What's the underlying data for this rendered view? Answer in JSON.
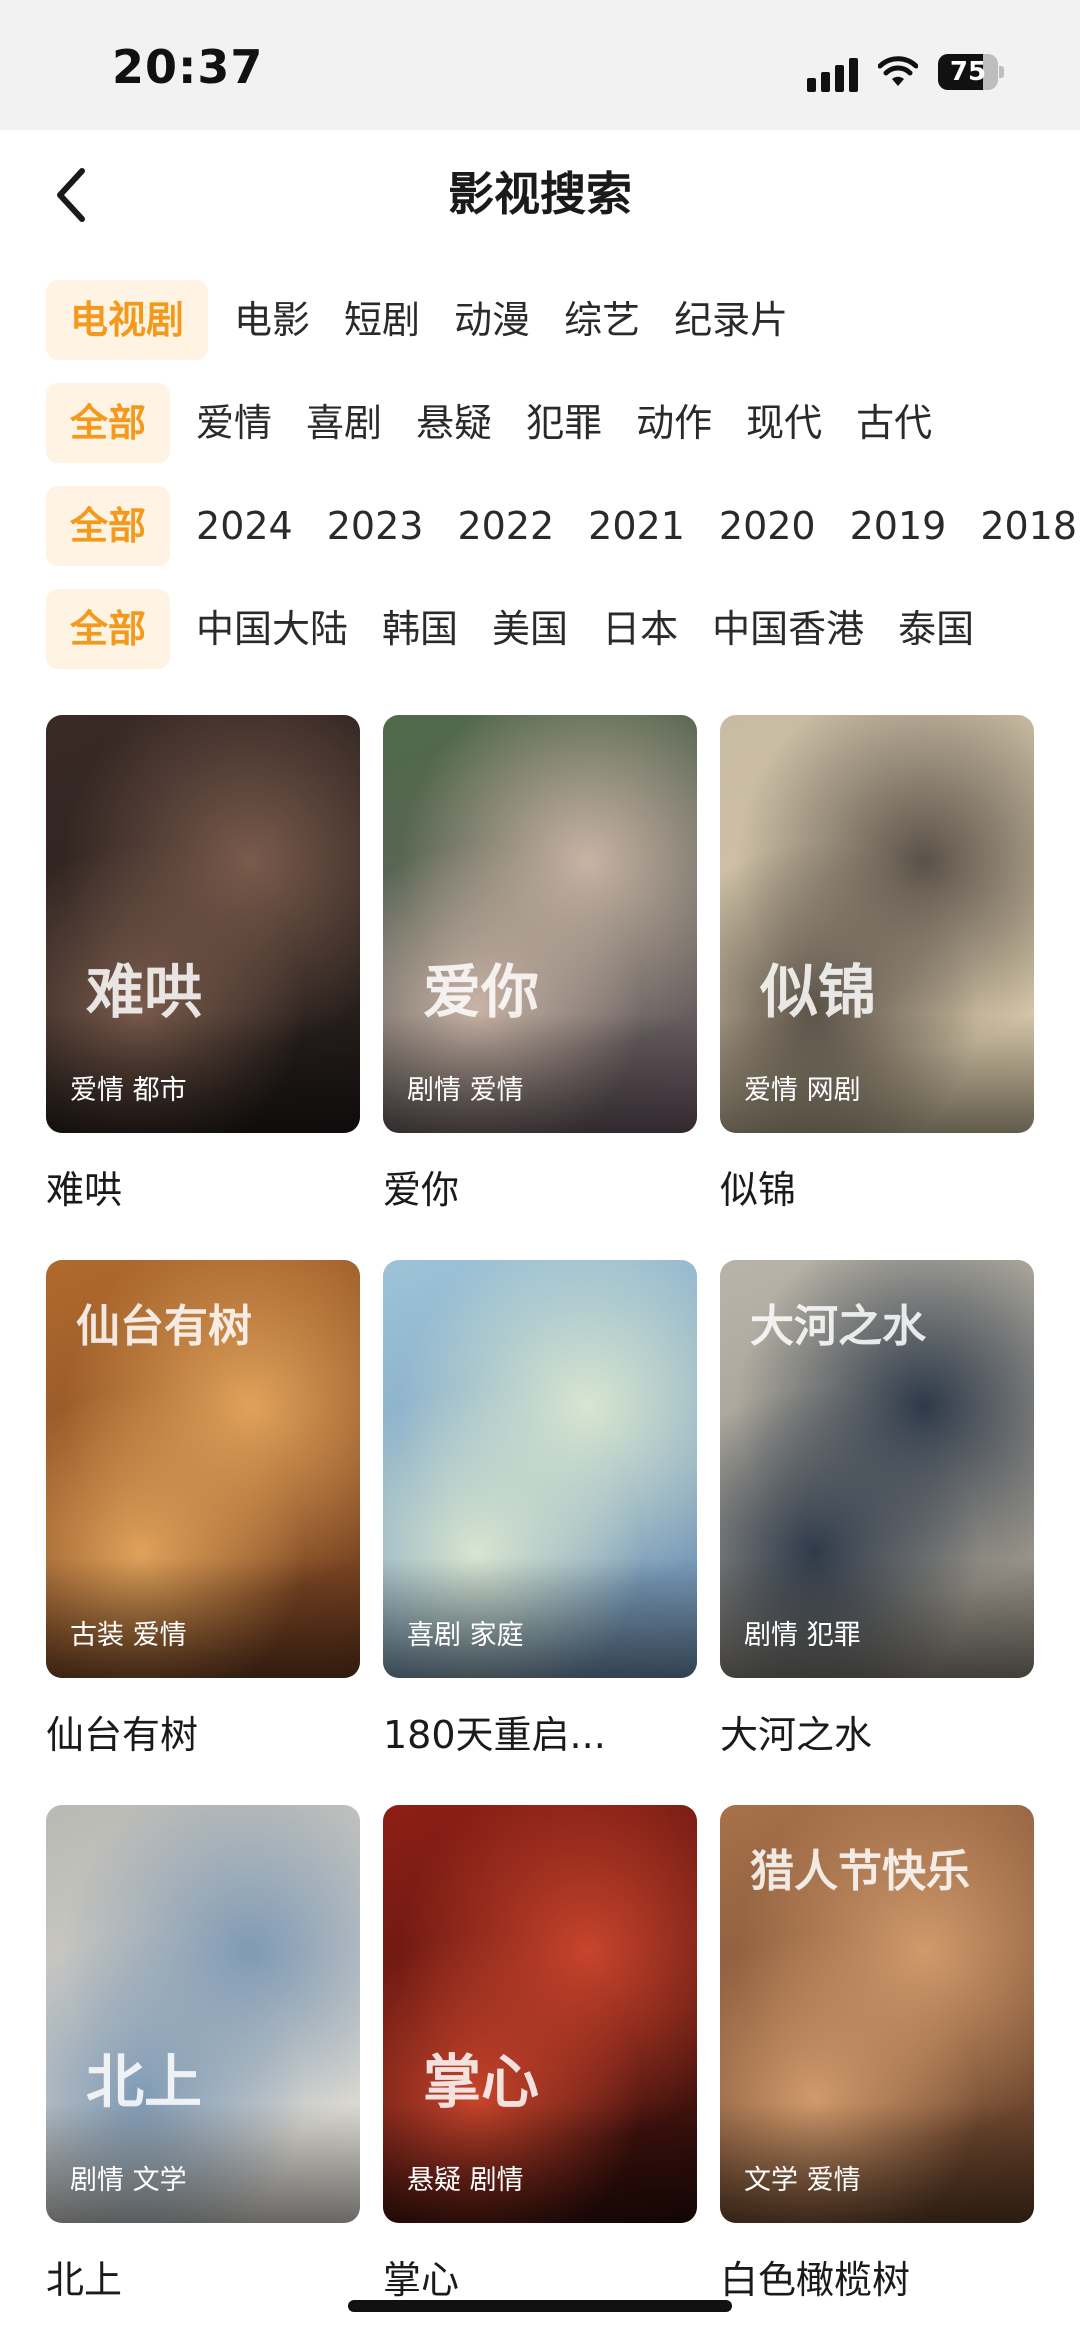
{
  "status": {
    "time": "20:37",
    "battery": "75",
    "battery_level": 0.75
  },
  "nav": {
    "title": "影视搜索"
  },
  "filters": {
    "types": [
      {
        "label": "电视剧",
        "active": true
      },
      {
        "label": "电影"
      },
      {
        "label": "短剧"
      },
      {
        "label": "动漫"
      },
      {
        "label": "综艺"
      },
      {
        "label": "纪录片"
      }
    ],
    "genres": [
      {
        "label": "全部",
        "active": true
      },
      {
        "label": "爱情"
      },
      {
        "label": "喜剧"
      },
      {
        "label": "悬疑"
      },
      {
        "label": "犯罪"
      },
      {
        "label": "动作"
      },
      {
        "label": "现代"
      },
      {
        "label": "古代"
      }
    ],
    "years": [
      {
        "label": "全部",
        "active": true
      },
      {
        "label": "2024"
      },
      {
        "label": "2023"
      },
      {
        "label": "2022"
      },
      {
        "label": "2021"
      },
      {
        "label": "2020"
      },
      {
        "label": "2019"
      },
      {
        "label": "2018"
      }
    ],
    "regions": [
      {
        "label": "全部",
        "active": true
      },
      {
        "label": "中国大陆"
      },
      {
        "label": "韩国"
      },
      {
        "label": "美国"
      },
      {
        "label": "日本"
      },
      {
        "label": "中国香港"
      },
      {
        "label": "泰国"
      }
    ]
  },
  "shows": [
    {
      "title": "难哄",
      "tags": "爱情 都市",
      "art": "难哄",
      "colors": [
        "#3a2a26",
        "#7a5b4c",
        "#1f1a18"
      ]
    },
    {
      "title": "爱你",
      "tags": "剧情 爱情",
      "art": "爱你",
      "colors": [
        "#4f6a4a",
        "#c9b3a5",
        "#6e5a66"
      ]
    },
    {
      "title": "似锦",
      "tags": "爱情 网剧",
      "art": "似锦",
      "colors": [
        "#c8bba4",
        "#5a5148",
        "#d8c9a8"
      ]
    },
    {
      "title": "仙台有树",
      "tags": "古装 爱情",
      "art": "仙台有树",
      "colors": [
        "#b06a2e",
        "#e0a25a",
        "#6b3a1f"
      ]
    },
    {
      "title": "180天重启...",
      "tags": "喜剧 家庭",
      "art": "",
      "colors": [
        "#9cc3d8",
        "#d8e6d0",
        "#6f8fb0"
      ]
    },
    {
      "title": "大河之水",
      "tags": "剧情 犯罪",
      "art": "大河之水",
      "colors": [
        "#b9b4a8",
        "#2e3a4a",
        "#8f8a80"
      ]
    },
    {
      "title": "北上",
      "tags": "剧情 文学",
      "art": "北上",
      "colors": [
        "#b9b9b4",
        "#7f9ab5",
        "#e6e3dc"
      ]
    },
    {
      "title": "掌心",
      "tags": "悬疑 剧情",
      "art": "掌心",
      "colors": [
        "#8e1f16",
        "#c8442c",
        "#2a0d0a"
      ]
    },
    {
      "title": "白色橄榄树",
      "tags": "文学 爱情",
      "art": "猎人节快乐",
      "colors": [
        "#a7714a",
        "#d19a6c",
        "#5e3b27"
      ]
    }
  ]
}
